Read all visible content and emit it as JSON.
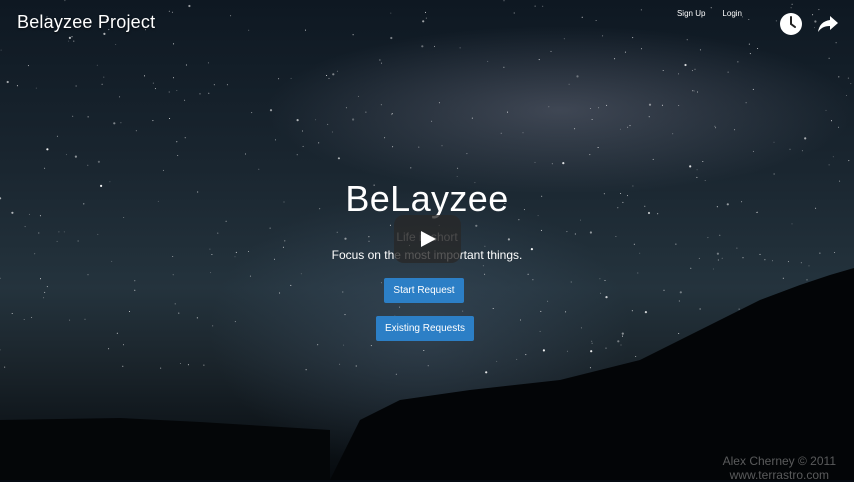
{
  "video": {
    "title": "Belayzee Project"
  },
  "nav": {
    "signup": "Sign Up",
    "login": "Login"
  },
  "icons": {
    "watch_later": "clock-icon",
    "share": "share-arrow-icon",
    "play": "play-icon"
  },
  "hero": {
    "title": "BeLayzee",
    "tagline": "Life is short",
    "focus": "Focus on the most important things."
  },
  "buttons": {
    "start": "Start Request",
    "existing": "Existing Requests"
  },
  "credit": {
    "line1": "Alex Cherney © 2011",
    "line2": "www.terrastro.com"
  },
  "colors": {
    "button": "#2c7fc6"
  }
}
